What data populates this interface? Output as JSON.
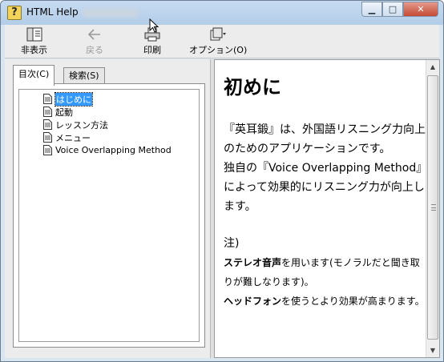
{
  "window": {
    "title": "HTML Help",
    "controls": {
      "minimize": "▁",
      "maximize": "□",
      "close": "✕"
    }
  },
  "toolbar": {
    "hide_label": "非表示",
    "back_label": "戻る",
    "print_label": "印刷",
    "options_label": "オプション(O)"
  },
  "tabs": {
    "contents": "目次(C)",
    "search": "検索(S)"
  },
  "tree": {
    "items": [
      {
        "label": "はじめに",
        "selected": true
      },
      {
        "label": "起動"
      },
      {
        "label": "レッスン方法"
      },
      {
        "label": "メニュー"
      },
      {
        "label": "Voice Overlapping Method"
      }
    ]
  },
  "content": {
    "heading": "初めに",
    "p1": "『英耳鍛』は、外国語リスニング力向上のためのアプリケーションです。",
    "p2": "独自の『Voice Overlapping Method』によって効果的にリスニング力が向上します。",
    "note_title": "注)",
    "note1_bold": "ステレオ音声",
    "note1_rest": "を用います(モノラルだと聞き取りが難しなります)。",
    "note2_bold": "ヘッドフォン",
    "note2_rest": "を使うとより効果が高まります。"
  },
  "colors": {
    "selection": "#3399ff",
    "titlebar": "#c6dbf1",
    "close_button": "#c44a35"
  }
}
